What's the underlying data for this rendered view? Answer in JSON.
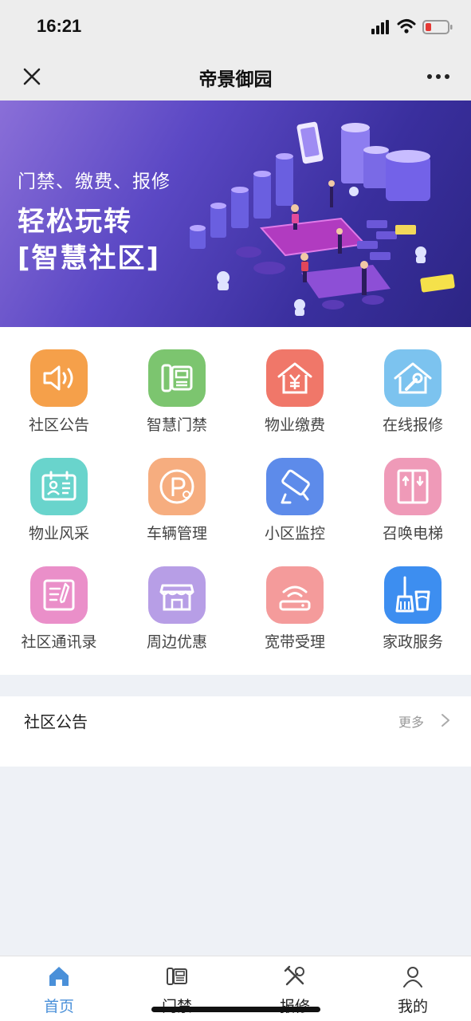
{
  "status": {
    "time": "16:21"
  },
  "nav": {
    "title": "帝景御园"
  },
  "banner": {
    "subtitle": "门禁、缴费、报修",
    "headline_line1": "轻松玩转",
    "headline_line2": "[智慧社区]"
  },
  "grid": {
    "items": [
      {
        "label": "社区公告",
        "icon": "speaker-icon",
        "color": "#f5a04a"
      },
      {
        "label": "智慧门禁",
        "icon": "door-phone-icon",
        "color": "#7cc56f"
      },
      {
        "label": "物业缴费",
        "icon": "yuan-house-icon",
        "color": "#f07769"
      },
      {
        "label": "在线报修",
        "icon": "wrench-house-icon",
        "color": "#7cc3ef"
      },
      {
        "label": "物业风采",
        "icon": "id-card-icon",
        "color": "#69d4cc"
      },
      {
        "label": "车辆管理",
        "icon": "parking-icon",
        "color": "#f6ad7f"
      },
      {
        "label": "小区监控",
        "icon": "camera-icon",
        "color": "#5d8bea"
      },
      {
        "label": "召唤电梯",
        "icon": "elevator-icon",
        "color": "#ef9ab8"
      },
      {
        "label": "社区通讯录",
        "icon": "address-book-icon",
        "color": "#ea8fc9"
      },
      {
        "label": "周边优惠",
        "icon": "store-icon",
        "color": "#b79ee6"
      },
      {
        "label": "宽带受理",
        "icon": "router-icon",
        "color": "#f49b9b"
      },
      {
        "label": "家政服务",
        "icon": "broom-icon",
        "color": "#3d8ef0"
      }
    ]
  },
  "notice": {
    "title": "社区公告",
    "more_label": "更多"
  },
  "tabs": [
    {
      "label": "首页",
      "icon": "home-icon",
      "active": true
    },
    {
      "label": "门禁",
      "icon": "door-phone-icon",
      "active": false
    },
    {
      "label": "报修",
      "icon": "tools-icon",
      "active": false
    },
    {
      "label": "我的",
      "icon": "user-icon",
      "active": false
    }
  ],
  "colors": {
    "accent": "#4a90d9",
    "background": "#eef1f6"
  }
}
